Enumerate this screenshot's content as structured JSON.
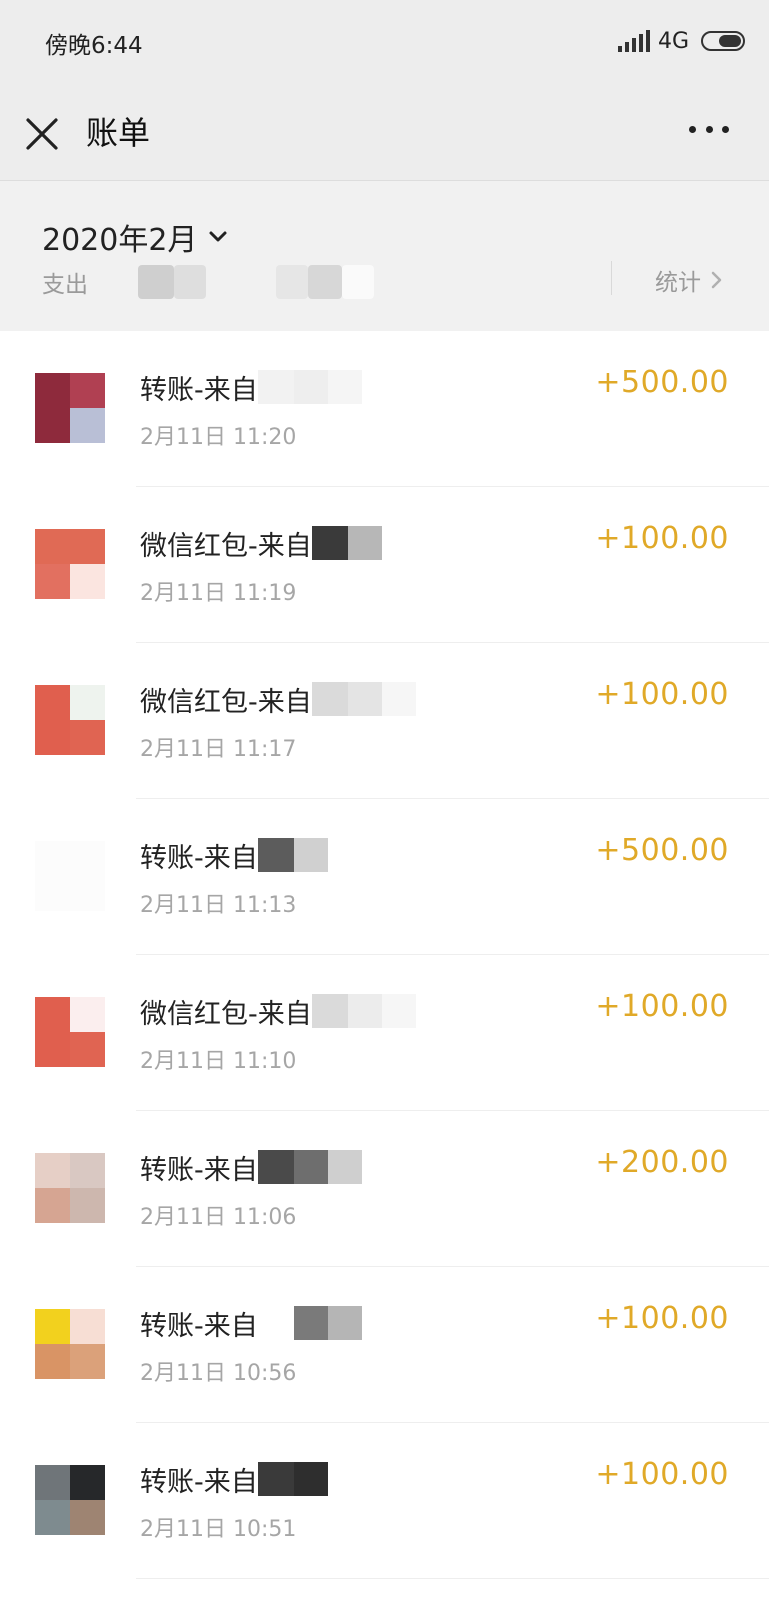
{
  "status_bar": {
    "time": "傍晚6:44",
    "network": "4G"
  },
  "nav": {
    "title": "账单"
  },
  "month": {
    "label": "2020年2月",
    "summary_label": "支出",
    "stats_label": "统计"
  },
  "colors": {
    "amount": "#e0a928",
    "background": "#ededed"
  },
  "bills": [
    {
      "title": "转账-来自",
      "time": "2月11日 11:20",
      "amount": "+500.00"
    },
    {
      "title": "微信红包-来自",
      "time": "2月11日 11:19",
      "amount": "+100.00"
    },
    {
      "title": "微信红包-来自",
      "time": "2月11日 11:17",
      "amount": "+100.00"
    },
    {
      "title": "转账-来自",
      "time": "2月11日 11:13",
      "amount": "+500.00"
    },
    {
      "title": "微信红包-来自",
      "time": "2月11日 11:10",
      "amount": "+100.00"
    },
    {
      "title": "转账-来自",
      "time": "2月11日 11:06",
      "amount": "+200.00"
    },
    {
      "title": "转账-来自",
      "time": "2月11日 10:56",
      "amount": "+100.00"
    },
    {
      "title": "转账-来自",
      "time": "2月11日 10:51",
      "amount": "+100.00"
    }
  ]
}
